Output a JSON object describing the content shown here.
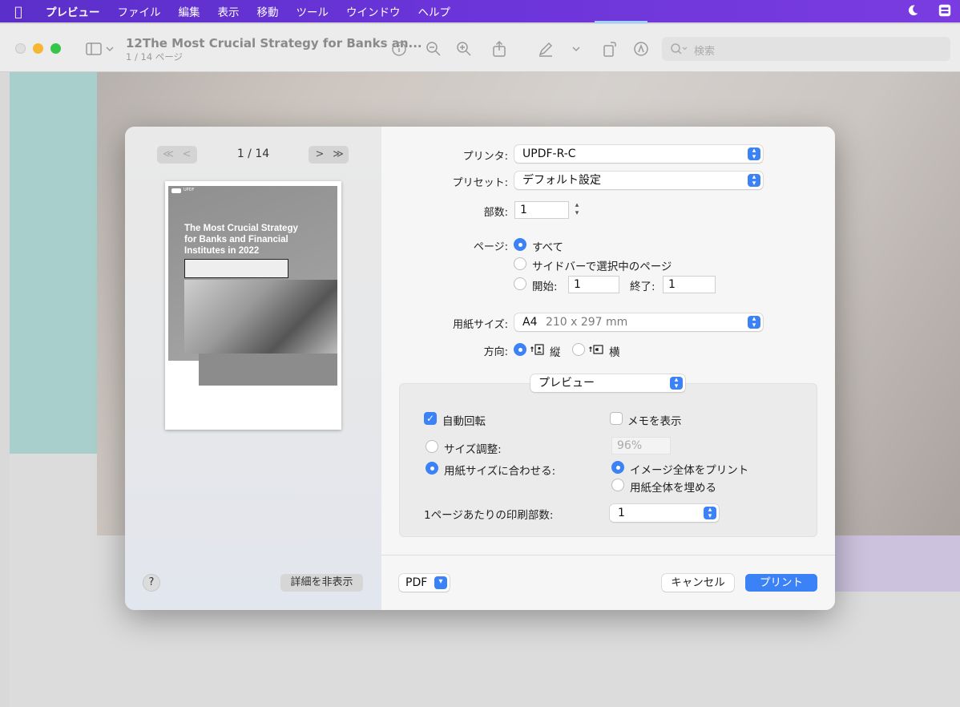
{
  "menubar": {
    "items": [
      "プレビュー",
      "ファイル",
      "編集",
      "表示",
      "移動",
      "ツール",
      "ウインドウ",
      "ヘルプ"
    ]
  },
  "toolbar": {
    "title": "12The Most Crucial Strategy for Banks an...",
    "subtitle": "1 / 14 ページ",
    "search_placeholder": "検索"
  },
  "dialog": {
    "nav": {
      "first": "≪",
      "prev": "<",
      "next": ">",
      "last": "≫",
      "page_count": "1 / 14"
    },
    "thumbnail": {
      "logo_text": "UPDF",
      "title": "The Most Crucial Strategy for Banks and Financial Institutes in 2022"
    },
    "help": "?",
    "hide_details": "詳細を非表示",
    "printer": {
      "label": "プリンタ:",
      "value": "UPDF-R-C"
    },
    "preset": {
      "label": "プリセット:",
      "value": "デフォルト設定"
    },
    "copies": {
      "label": "部数:",
      "value": "1"
    },
    "pages": {
      "label": "ページ:",
      "all": "すべて",
      "sidebar": "サイドバーで選択中のページ",
      "from_label": "開始:",
      "from": "1",
      "to_label": "終了:",
      "to": "1"
    },
    "paper": {
      "label": "用紙サイズ:",
      "size": "A4",
      "dims": "210 x 297 mm"
    },
    "orientation": {
      "label": "方向:",
      "portrait": "縦",
      "landscape": "横"
    },
    "section_select": "プレビュー",
    "auto_rotate": "自動回転",
    "show_notes": "メモを表示",
    "scale_label": "サイズ調整:",
    "scale_value": "96%",
    "fit_label": "用紙サイズに合わせる:",
    "print_entire": "イメージ全体をプリント",
    "fill_paper": "用紙全体を埋める",
    "per_page_label": "1ページあたりの印刷部数:",
    "per_page_value": "1",
    "pdf": "PDF",
    "cancel": "キャンセル",
    "print": "プリント"
  },
  "colors": {
    "accent": "#3b82f6",
    "menubar": "#6a34d8"
  }
}
